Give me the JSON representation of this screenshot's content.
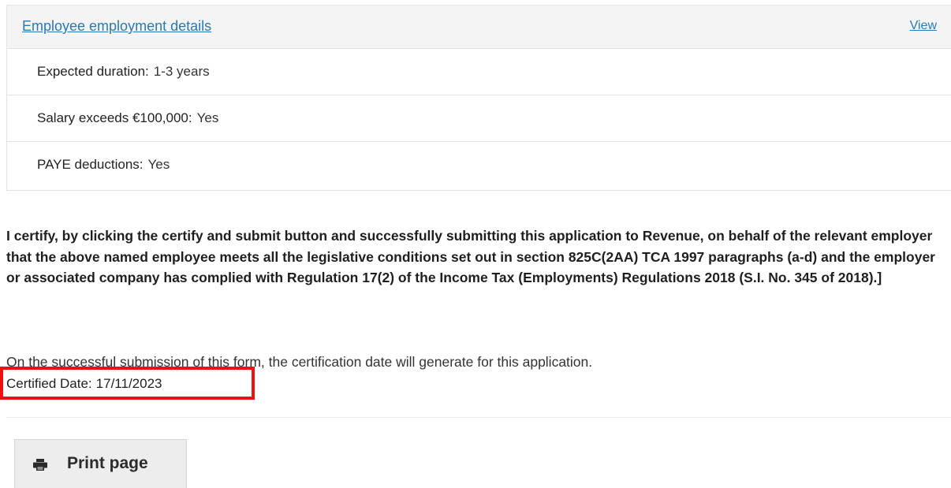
{
  "panel": {
    "title": "Employee employment details",
    "view_link": "View",
    "rows": [
      {
        "label": "Expected duration:",
        "value": "1-3 years"
      },
      {
        "label": "Salary exceeds €100,000:",
        "value": "Yes"
      },
      {
        "label": "PAYE deductions:",
        "value": "Yes"
      }
    ]
  },
  "certification": {
    "statement": "I certify, by clicking the certify and submit button and successfully submitting this application to Revenue, on behalf of the relevant employer that the above named employee meets all the legislative conditions set out in section 825C(2AA) TCA 1997 paragraphs (a-d) and the employer or associated company has complied with Regulation 17(2) of the Income Tax (Employments) Regulations 2018 (S.I. No. 345 of 2018).]",
    "note": "On the successful submission of this form, the certification date will generate for this application.",
    "date_label": "Certified Date:",
    "date_value": "17/11/2023",
    "highlight_color": "#ee1111"
  },
  "actions": {
    "print_label": "Print page",
    "print_icon": "printer-icon"
  }
}
